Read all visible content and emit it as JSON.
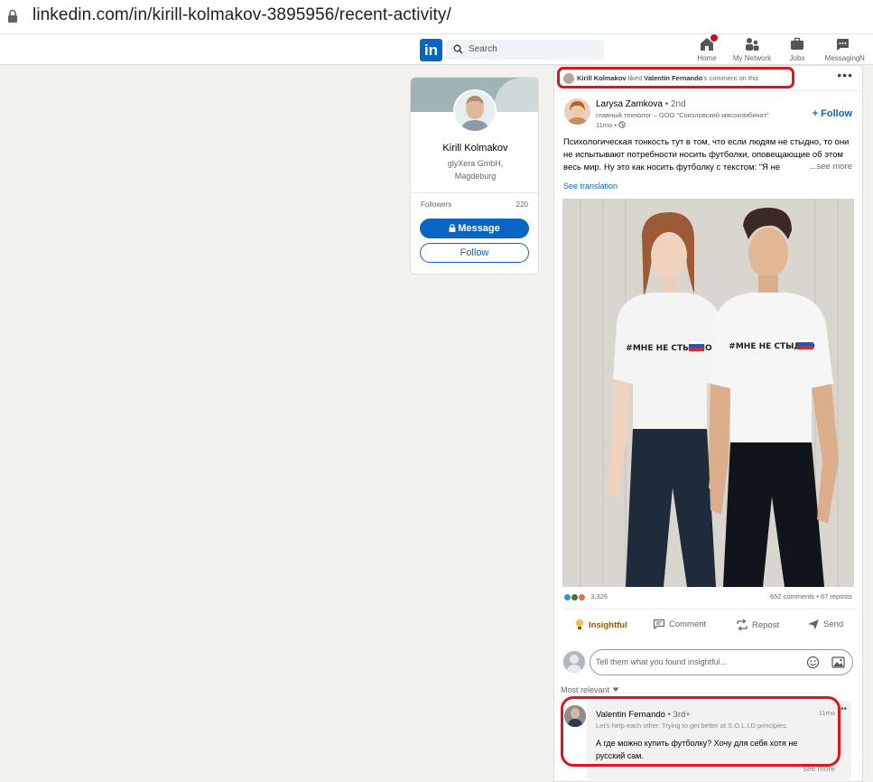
{
  "browser": {
    "url": "linkedin.com/in/kirill-kolmakov-3895956/recent-activity/"
  },
  "nav": {
    "logo": "in",
    "search_placeholder": "Search",
    "items": [
      {
        "label": "Home",
        "icon": "home-icon"
      },
      {
        "label": "My Network",
        "icon": "network-icon"
      },
      {
        "label": "Jobs",
        "icon": "briefcase-icon"
      },
      {
        "label": "Messaging",
        "icon": "messaging-icon"
      },
      {
        "label": "N",
        "icon": "notifications-icon"
      }
    ]
  },
  "profile": {
    "name": "Kirill Kolmakov",
    "company": "glyXera GmbH,",
    "location": "Magdeburg",
    "followers_label": "Followers",
    "followers_count": "220",
    "message_label": "Message",
    "follow_label": "Follow"
  },
  "activity": {
    "actor": "Kirill Kolmakov",
    "verb": "liked",
    "target": "Valentin Fernando",
    "suffix": "'s comment on this",
    "more": "•••"
  },
  "post": {
    "author": "Larysa Zamkova",
    "degree": "• 2nd",
    "headline": "главный технолог – ООО \"Соколовский мясокомбинат\"",
    "time": "11mo •",
    "follow": "+ Follow",
    "body": "Психологическая тонкость тут в том, что если людям не стыдно, то они не испытывают потребности носить футболки, оповещающие об этом весь мир. Ну это как носить футболку с текстом: \"Я не",
    "see_more": "...see more",
    "see_translation": "See translation",
    "shirt_text": "#МНЕ НЕ СТЫДНО",
    "reactions": "3,326",
    "comments_reposts": "652 comments • 67 reposts",
    "actions": [
      "Insightful",
      "Comment",
      "Repost",
      "Send"
    ]
  },
  "comment_box": {
    "placeholder": "Tell them what you found insightful...",
    "sort": "Most relevant"
  },
  "comment": {
    "name": "Valentin Fernando",
    "degree": "• 3rd+",
    "headline": "Let's help each other. Trying to get better at S.O.L.I.D principles.",
    "time": "11mo",
    "more": "•••",
    "text": "А где можно купить футболку? Хочу для себя хотя не русский сам.",
    "see_more": "see more"
  },
  "colors": {
    "brand": "#0a66c2",
    "highlight": "#e0141e",
    "insightful": "#915907"
  }
}
